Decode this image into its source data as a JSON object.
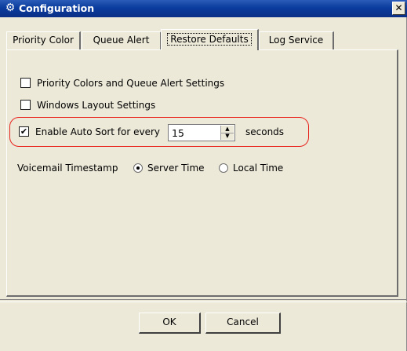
{
  "window": {
    "title": "Configuration",
    "close_glyph": "✕",
    "icon": "gear-icon"
  },
  "tabs": [
    {
      "label": "Priority Color",
      "active": false
    },
    {
      "label": "Queue Alert",
      "active": false
    },
    {
      "label": "Restore Defaults",
      "active": true
    },
    {
      "label": "Log Service",
      "active": false
    }
  ],
  "restore": {
    "priority_colors": {
      "label": "Priority Colors and Queue Alert Settings",
      "checked": false
    },
    "windows_layout": {
      "label": "Windows Layout Settings",
      "checked": false
    },
    "auto_sort": {
      "label": "Enable Auto Sort for every",
      "checked": true,
      "value": "15",
      "unit": "seconds"
    }
  },
  "voicemail": {
    "label": "Voicemail Timestamp",
    "options": [
      {
        "label": "Server Time",
        "selected": true
      },
      {
        "label": "Local Time",
        "selected": false
      }
    ]
  },
  "buttons": {
    "ok": "OK",
    "cancel": "Cancel"
  },
  "colors": {
    "title_bar": "#0a3c9e",
    "highlight": "#e8231e",
    "dialog_bg": "#ece9d8"
  }
}
